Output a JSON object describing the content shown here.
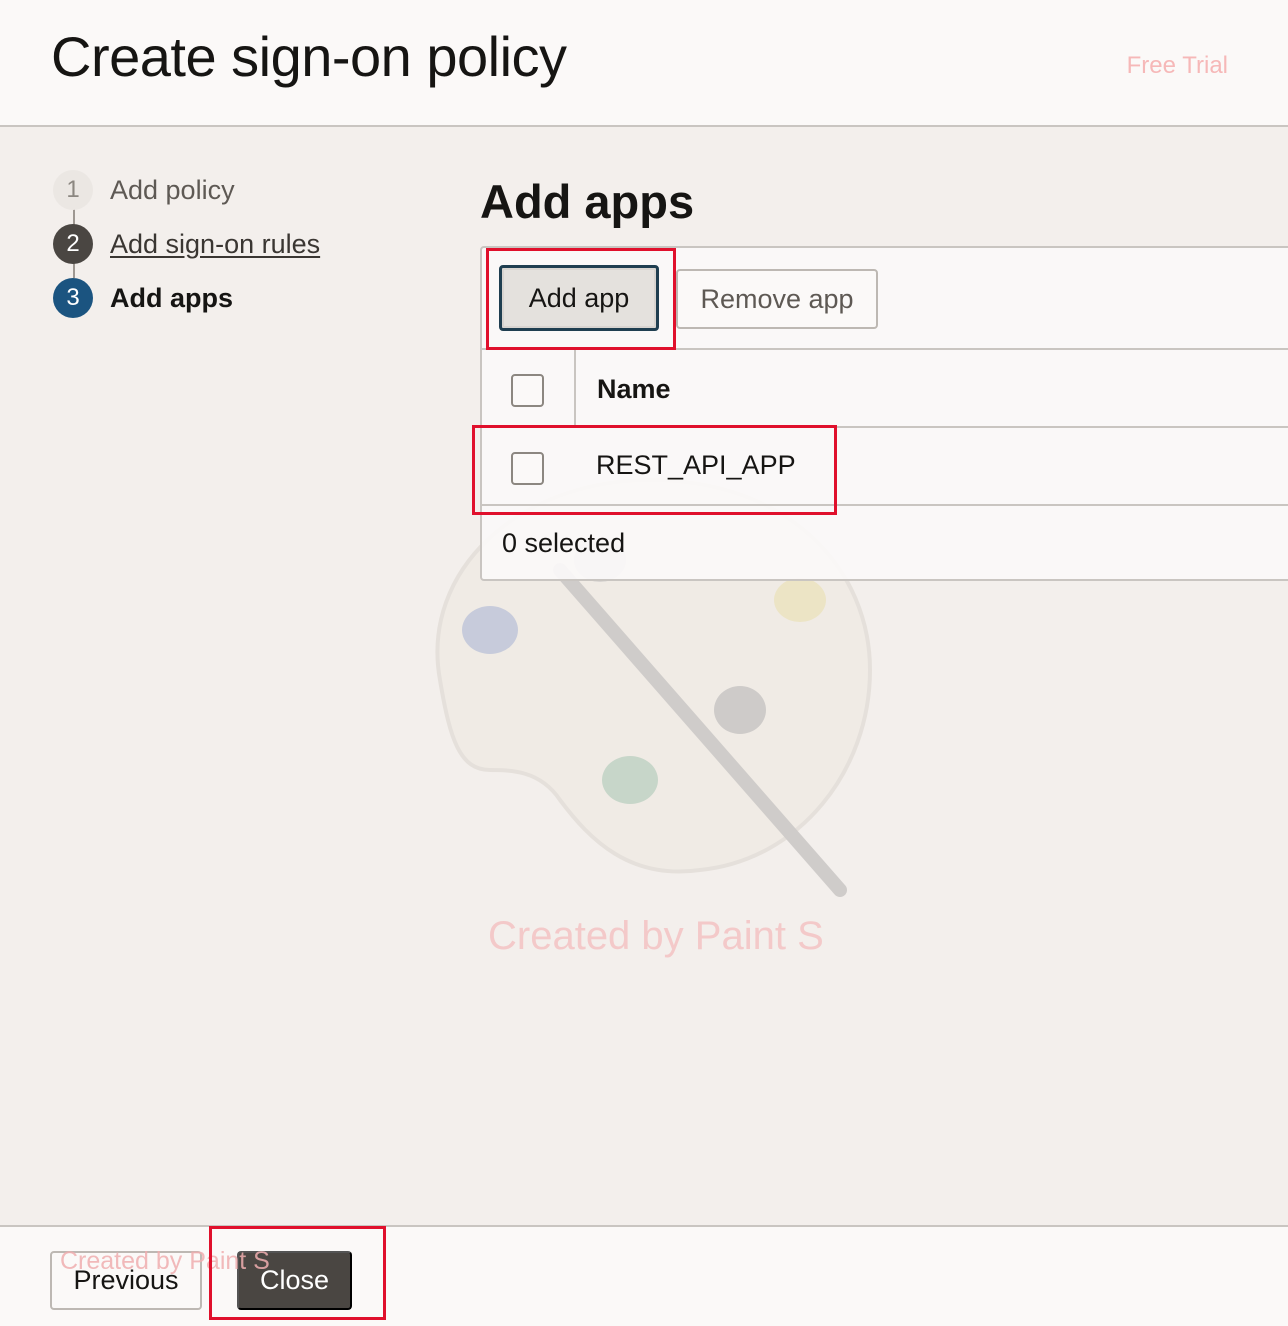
{
  "header": {
    "title": "Create sign-on policy",
    "free_trial": "Free Trial"
  },
  "stepper": {
    "steps": [
      {
        "number": "1",
        "label": "Add policy",
        "state": "completed"
      },
      {
        "number": "2",
        "label": "Add sign-on rules",
        "state": "link"
      },
      {
        "number": "3",
        "label": "Add apps",
        "state": "current"
      }
    ]
  },
  "section": {
    "title": "Add apps",
    "toolbar": {
      "add_app_label": "Add app",
      "remove_app_label": "Remove app"
    },
    "table": {
      "columns": [
        "Name"
      ],
      "rows": [
        {
          "name": "REST_API_APP",
          "selected": false
        }
      ],
      "status": "0 selected"
    }
  },
  "footer": {
    "previous_label": "Previous",
    "close_label": "Close"
  },
  "watermark": {
    "text": "Created by Paint S",
    "text_small": "Created by Paint S"
  },
  "colors": {
    "accent_step": "#1b5480",
    "annotation_red": "#e0102c",
    "close_button": "#4a4642"
  }
}
